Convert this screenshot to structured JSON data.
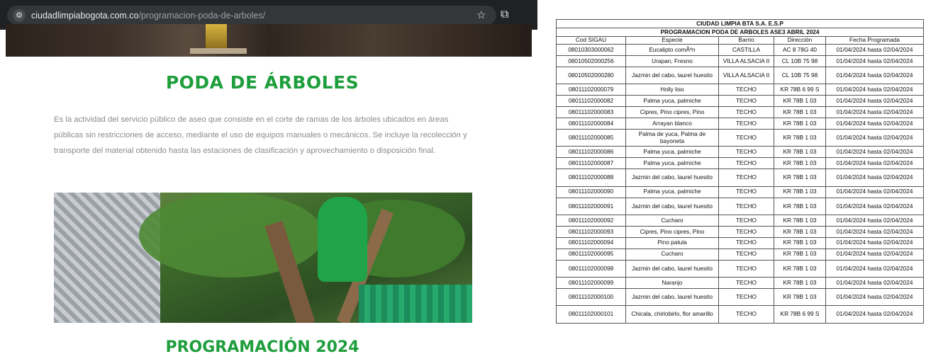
{
  "browser": {
    "address_bar": {
      "domain": "ciudadlimpiabogota.com.co",
      "path": "/programacion-poda-de-arboles/",
      "site_icon": "tune-icon",
      "star_icon": "☆",
      "extension_icon": "puzzle-icon"
    },
    "page": {
      "title": "PODA DE ÁRBOLES",
      "description": "Es la actividad del servicio público de aseo que consiste en el corte de ramas de los árboles ubicados en áreas públicas sin restricciones de acceso, mediante el uso de equipos manuales o mecánicos. Se incluye la recolección y transporte del material obtenido hasta las estaciones de clasificación y aprovechamiento o disposición final.",
      "section_title": "PROGRAMACIÓN 2024",
      "accent_color": "#1e9e3c"
    }
  },
  "schedule": {
    "company": "CIUDAD LIMPIA BTA S.A. E.S.P",
    "title": "PROGRAMACION PODA DE ARBOLES ASE3 ABRIL 2024",
    "headers": [
      "Cod SIGAU",
      "Especie",
      "Barrio",
      "Dirección",
      "Fecha Programada"
    ],
    "rows": [
      [
        "08010303000062",
        "Eucalipto comÃºn",
        "CASTILLA",
        "AC 8 78G 40",
        "01/04/2024 hasta 02/04/2024"
      ],
      [
        "08010502000256",
        "Urapan, Fresno",
        "VILLA ALSACIA II",
        "CL 10B 75 98",
        "01/04/2024 hasta 02/04/2024"
      ],
      [
        "08010502000280",
        "Jazmin del cabo, laurel huesito",
        "VILLA ALSACIA II",
        "CL 10B 75 98",
        "01/04/2024 hasta 02/04/2024"
      ],
      [
        "08011102000079",
        "Holly liso",
        "TECHO",
        "KR 78B 6 99 S",
        "01/04/2024 hasta 02/04/2024"
      ],
      [
        "08011102000082",
        "Palma yuca, palmiche",
        "TECHO",
        "KR 78B 1 03",
        "01/04/2024 hasta 02/04/2024"
      ],
      [
        "08011102000083",
        "Cipres, Pino cipres, Pino",
        "TECHO",
        "KR 78B 1 03",
        "01/04/2024 hasta 02/04/2024"
      ],
      [
        "08011102000084",
        "Arrayan blanco",
        "TECHO",
        "KR 78B 1 03",
        "01/04/2024 hasta 02/04/2024"
      ],
      [
        "08011102000085",
        "Palma de yuca, Palma de bayoneta",
        "TECHO",
        "KR 78B 1 03",
        "01/04/2024 hasta 02/04/2024"
      ],
      [
        "08011102000086",
        "Palma yuca, palmiche",
        "TECHO",
        "KR 78B 1 03",
        "01/04/2024 hasta 02/04/2024"
      ],
      [
        "08011102000087",
        "Palma yuca, palmiche",
        "TECHO",
        "KR 78B 1 03",
        "01/04/2024 hasta 02/04/2024"
      ],
      [
        "08011102000088",
        "Jazmin del cabo, laurel huesito",
        "TECHO",
        "KR 78B 1 03",
        "01/04/2024 hasta 02/04/2024"
      ],
      [
        "08011102000090",
        "Palma yuca, palmiche",
        "TECHO",
        "KR 78B 1 03",
        "01/04/2024 hasta 02/04/2024"
      ],
      [
        "08011102000091",
        "Jazmin del cabo, laurel huesito",
        "TECHO",
        "KR 78B 1 03",
        "01/04/2024 hasta 02/04/2024"
      ],
      [
        "08011102000092",
        "Cucharo",
        "TECHO",
        "KR 78B 1 03",
        "01/04/2024 hasta 02/04/2024"
      ],
      [
        "08011102000093",
        "Cipres, Pino cipres, Pino",
        "TECHO",
        "KR 78B 1 03",
        "01/04/2024 hasta 02/04/2024"
      ],
      [
        "08011102000094",
        "Pino patula",
        "TECHO",
        "KR 78B 1 03",
        "01/04/2024 hasta 02/04/2024"
      ],
      [
        "08011102000095",
        "Cucharo",
        "TECHO",
        "KR 78B 1 03",
        "01/04/2024 hasta 02/04/2024"
      ],
      [
        "08011102000098",
        "Jazmin del cabo, laurel huesito",
        "TECHO",
        "KR 78B 1 03",
        "01/04/2024 hasta 02/04/2024"
      ],
      [
        "08011102000099",
        "Naranjo",
        "TECHO",
        "KR 78B 1 03",
        "01/04/2024 hasta 02/04/2024"
      ],
      [
        "08011102000100",
        "Jazmin del cabo, laurel huesito",
        "TECHO",
        "KR 78B 1 03",
        "01/04/2024 hasta 02/04/2024"
      ],
      [
        "08011102000101",
        "Chicala, chirlobirlo, flor amarillo",
        "TECHO",
        "KR 78B 6 99 S",
        "01/04/2024 hasta 02/04/2024"
      ]
    ]
  }
}
